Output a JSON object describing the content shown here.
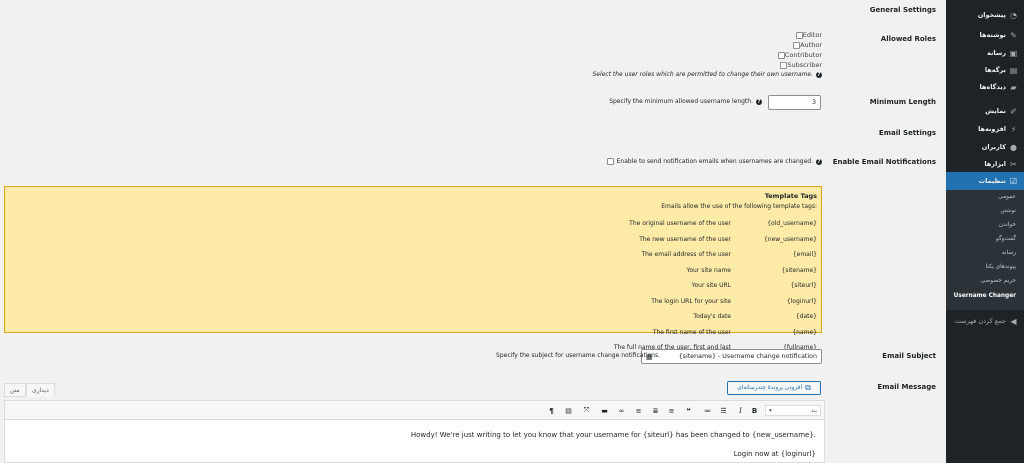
{
  "sidebar": {
    "items": [
      {
        "label": "پیشخوان",
        "icon": "dashboard-icon",
        "glyph": "◔"
      },
      {
        "label": "نوشته‌ها",
        "icon": "posts-icon",
        "glyph": "✎"
      },
      {
        "label": "رسانه",
        "icon": "media-icon",
        "glyph": "▣"
      },
      {
        "label": "برگه‌ها",
        "icon": "pages-icon",
        "glyph": "▤"
      },
      {
        "label": "دیدگاه‌ها",
        "icon": "comments-icon",
        "glyph": "▰"
      },
      {
        "label": "نمایش",
        "icon": "appearance-icon",
        "glyph": "✐"
      },
      {
        "label": "افزونه‌ها",
        "icon": "plugins-icon",
        "glyph": "⚡"
      },
      {
        "label": "کاربران",
        "icon": "users-icon",
        "glyph": "●"
      },
      {
        "label": "ابزارها",
        "icon": "tools-icon",
        "glyph": "✂"
      },
      {
        "label": "تنظیمات",
        "icon": "settings-icon",
        "glyph": "☑"
      }
    ],
    "submenu": [
      "عمومی",
      "نوشتن",
      "خواندن",
      "گفت‌وگو",
      "رسانه",
      "پیوندهای یکتا",
      "حریم خصوصی",
      "Username Changer"
    ],
    "collapse_label": "جمع کردن فهرست"
  },
  "general_settings": {
    "heading": "General Settings"
  },
  "allowed_roles": {
    "label": "Allowed Roles",
    "roles": [
      "Editor",
      "Author",
      "Contributor",
      "Subscriber"
    ],
    "description": "Select the user roles which are permitted to change their own username."
  },
  "minimum_length": {
    "label": "Minimum Length",
    "value": "3",
    "description": "Specify the minimum allowed username length."
  },
  "email_settings": {
    "heading": "Email Settings"
  },
  "email_notifications": {
    "label": "Enable Email Notifications",
    "description": "Enable to send notification emails when usernames are changed."
  },
  "template_tags": {
    "title": "Template Tags",
    "subtitle": "Emails allow the use of the following template tags:",
    "rows": [
      {
        "code": "{old_username}",
        "desc": "The original username of the user"
      },
      {
        "code": "{new_username}",
        "desc": "The new username of the user"
      },
      {
        "code": "{email}",
        "desc": "The email address of the user"
      },
      {
        "code": "{sitename}",
        "desc": "Your site name"
      },
      {
        "code": "{siteurl}",
        "desc": "Your site URL"
      },
      {
        "code": "{loginurl}",
        "desc": "The login URL for your site"
      },
      {
        "code": "{date}",
        "desc": "Today's date"
      },
      {
        "code": "{name}",
        "desc": "The first name of the user"
      },
      {
        "code": "{fullname}",
        "desc": "The full name of the user, first and last"
      }
    ]
  },
  "email_subject": {
    "label": "Email Subject",
    "value": "{sitename} - Username change notification",
    "description": "Specify the subject for username change notifications."
  },
  "email_message": {
    "label": "Email Message",
    "media_button": "افزودن پروندهٔ چندرسانه‌ای",
    "tab_visual": "دیداری",
    "tab_text": "متن",
    "format_value": "بند",
    "lines": [
      "Howdy! We're just writing to let you know that your username for {siteurl} has been changed to {new_username}.",
      "Login now at {loginurl}"
    ]
  }
}
